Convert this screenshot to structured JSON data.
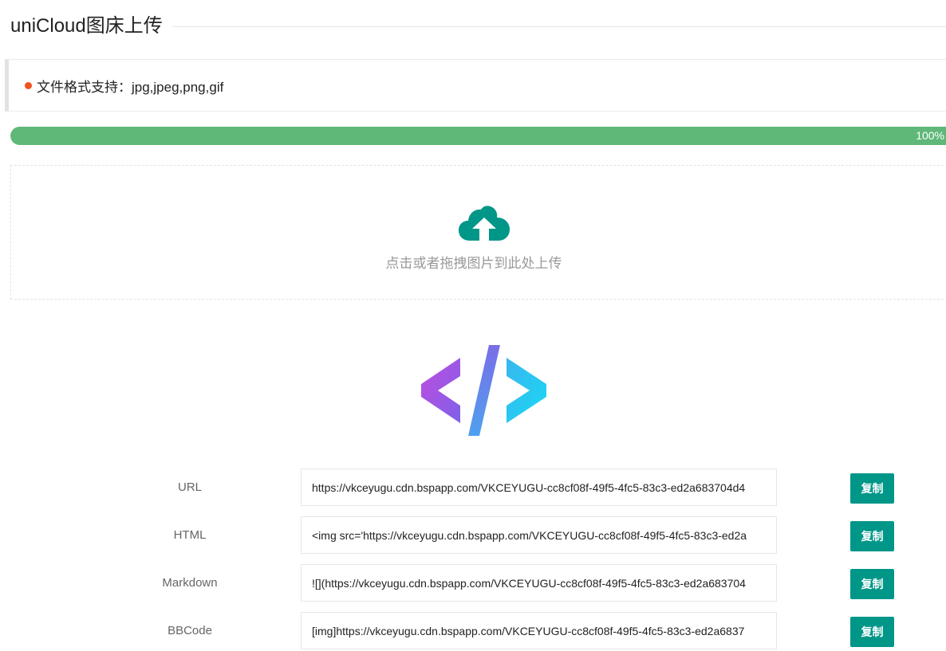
{
  "header": {
    "title": "uniCloud图床上传"
  },
  "notice": {
    "text": "文件格式支持：jpg,jpeg,png,gif"
  },
  "progress": {
    "percent": 100,
    "label": "100%"
  },
  "upload": {
    "hint": "点击或者拖拽图片到此处上传",
    "icon": "cloud-upload-icon",
    "icon_color": "#009688"
  },
  "logo": {
    "icon": "code-icon"
  },
  "links": [
    {
      "label": "URL",
      "value": "https://vkceyugu.cdn.bspapp.com/VKCEYUGU-cc8cf08f-49f5-4fc5-83c3-ed2a683704d4",
      "button": "复制"
    },
    {
      "label": "HTML",
      "value": "<img src='https://vkceyugu.cdn.bspapp.com/VKCEYUGU-cc8cf08f-49f5-4fc5-83c3-ed2a",
      "button": "复制"
    },
    {
      "label": "Markdown",
      "value": "![](https://vkceyugu.cdn.bspapp.com/VKCEYUGU-cc8cf08f-49f5-4fc5-83c3-ed2a683704",
      "button": "复制"
    },
    {
      "label": "BBCode",
      "value": "[img]https://vkceyugu.cdn.bspapp.com/VKCEYUGU-cc8cf08f-49f5-4fc5-83c3-ed2a6837",
      "button": "复制"
    }
  ],
  "colors": {
    "accent": "#009688",
    "progress": "#5fb878",
    "notice_dot": "#f0541e"
  }
}
